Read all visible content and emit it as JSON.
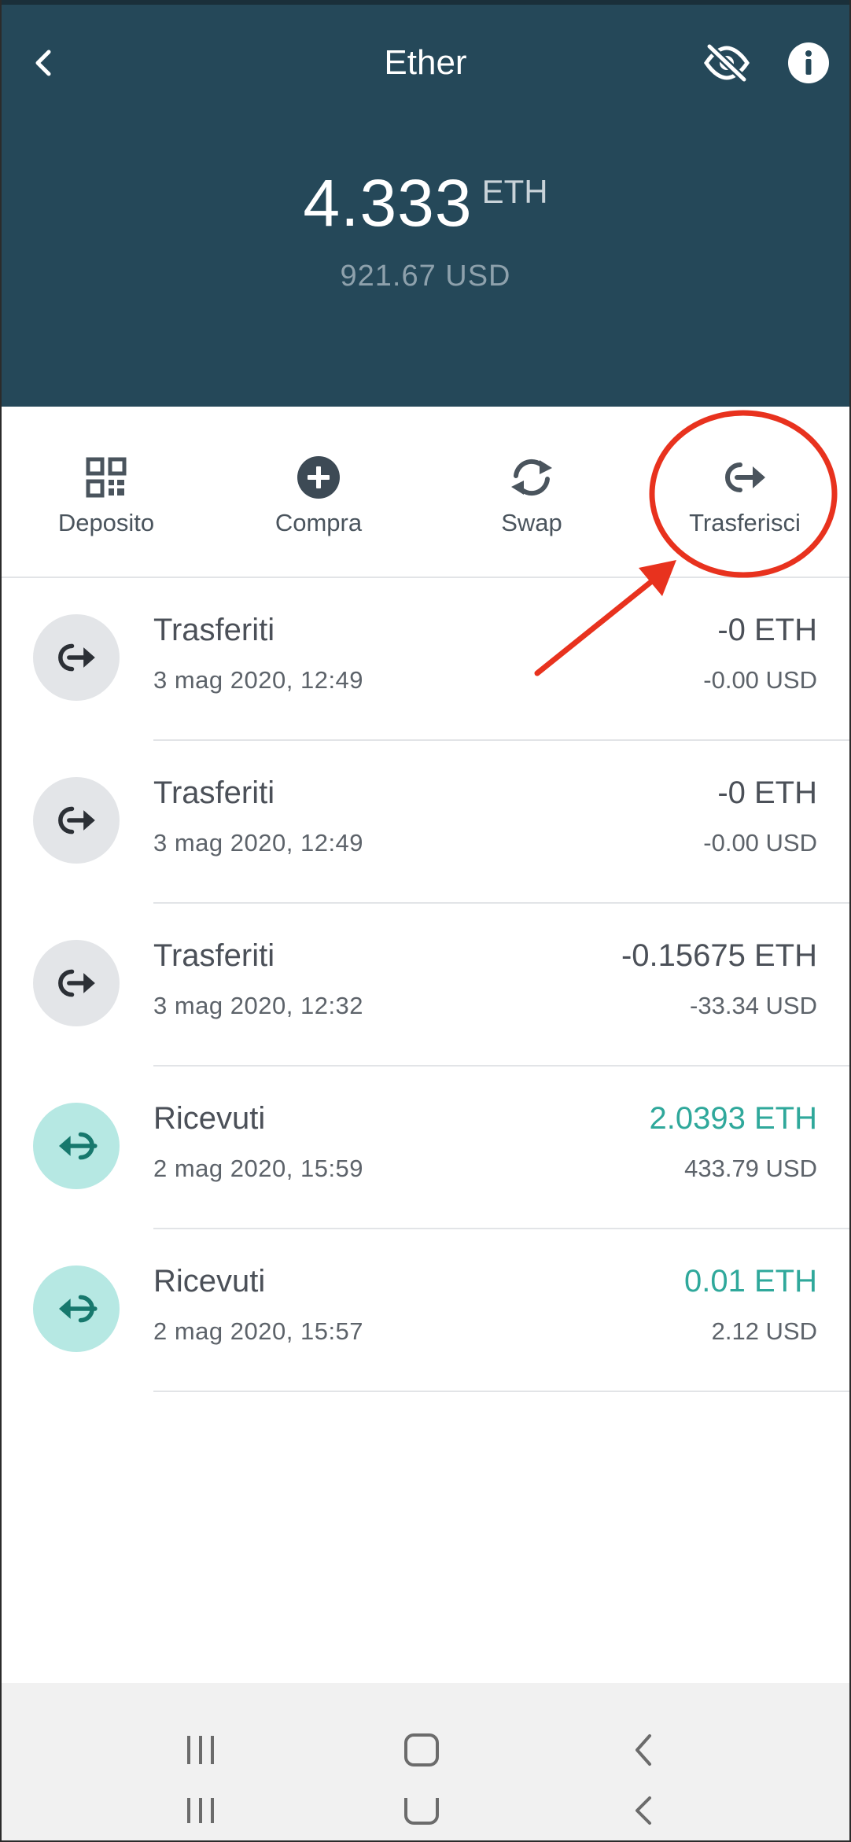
{
  "header": {
    "title": "Ether",
    "balance_amount": "4.333",
    "balance_unit": "ETH",
    "balance_fiat": "921.67 USD",
    "background_color": "#254859",
    "icons": [
      "back-arrow-icon",
      "eye-hidden-icon",
      "info-icon"
    ]
  },
  "actions": [
    {
      "label": "Deposito",
      "icon": "qr-code-icon"
    },
    {
      "label": "Compra",
      "icon": "plus-circle-icon"
    },
    {
      "label": "Swap",
      "icon": "swap-arrows-icon"
    },
    {
      "label": "Trasferisci",
      "icon": "transfer-out-icon",
      "highlighted": true
    }
  ],
  "transactions": [
    {
      "type": "Trasferiti",
      "date": "3 mag 2020, 12:49",
      "amount": "-0 ETH",
      "fiat": "-0.00 USD",
      "direction": "out"
    },
    {
      "type": "Trasferiti",
      "date": "3 mag 2020, 12:49",
      "amount": "-0 ETH",
      "fiat": "-0.00 USD",
      "direction": "out"
    },
    {
      "type": "Trasferiti",
      "date": "3 mag 2020, 12:32",
      "amount": "-0.15675 ETH",
      "fiat": "-33.34 USD",
      "direction": "out"
    },
    {
      "type": "Ricevuti",
      "date": "2 mag 2020, 15:59",
      "amount": "2.0393 ETH",
      "fiat": "433.79 USD",
      "direction": "in"
    },
    {
      "type": "Ricevuti",
      "date": "2 mag 2020, 15:57",
      "amount": "0.01 ETH",
      "fiat": "2.12 USD",
      "direction": "in"
    }
  ],
  "colors": {
    "positive_amount": "#2fa89b",
    "annotation": "#e8321e",
    "incoming_circle": "#b6e8e3",
    "outgoing_circle": "#e3e5e8"
  },
  "navbar": {
    "icons": [
      "recent-apps-icon",
      "home-icon",
      "back-icon"
    ]
  }
}
